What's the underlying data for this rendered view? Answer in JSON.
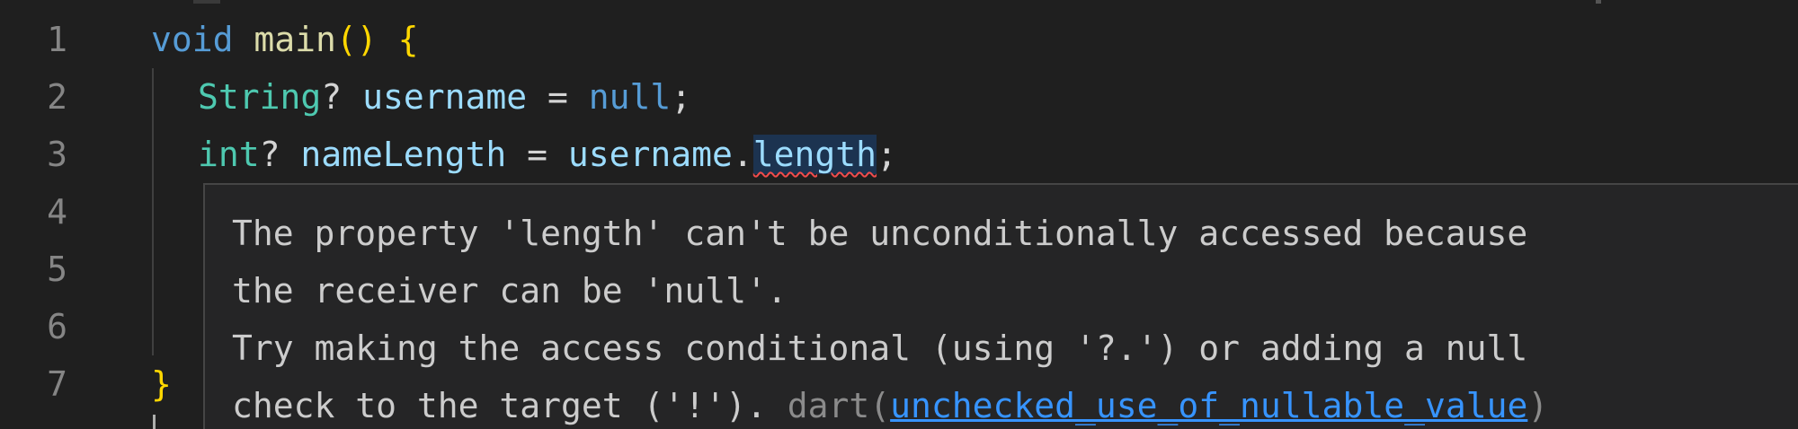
{
  "line_numbers": [
    "1",
    "2",
    "3",
    "4",
    "5",
    "6",
    "7"
  ],
  "code": {
    "line1": {
      "kw": "void",
      "sp": " ",
      "fn": "main",
      "paren": "()",
      "sp2": " ",
      "brace": "{"
    },
    "line2": {
      "type": "String",
      "q": "?",
      "sp": " ",
      "var": "username",
      "op": " = ",
      "lit": "null",
      "semi": ";"
    },
    "line3": {
      "type": "int",
      "q": "?",
      "sp": " ",
      "var": "nameLength",
      "op": " = ",
      "obj": "username",
      "dot": ".",
      "prop": "length",
      "semi": ";"
    },
    "line7": {
      "brace": "}"
    }
  },
  "hover": {
    "line1": "The property 'length' can't be unconditionally accessed because",
    "line2": "the receiver can be 'null'.",
    "line3": "Try making the access conditional (using '?.') or adding a null",
    "line4_text": "check to the target ('!'). ",
    "source": "dart",
    "paren_open": "(",
    "code": "unchecked_use_of_nullable_value",
    "paren_close": ")"
  }
}
